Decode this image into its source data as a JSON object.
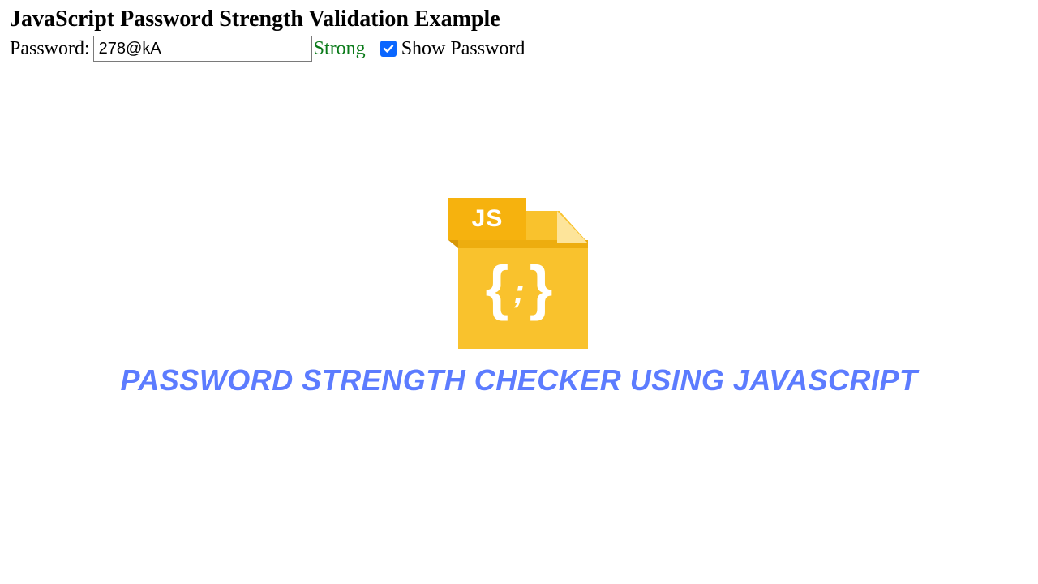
{
  "header": {
    "title": "JavaScript Password Strength Validation Example"
  },
  "form": {
    "password_label": "Password:",
    "password_value": "278@kA",
    "strength_text": "Strong",
    "show_password_label": "Show Password",
    "show_password_checked": true
  },
  "hero": {
    "icon_tag": "JS",
    "brace_left": "{",
    "brace_right": "}",
    "semicolon": ";",
    "title": "PASSWORD STRENGTH CHECKER USING JAVASCRIPT"
  },
  "colors": {
    "accent": "#0a66ff",
    "strength_ok": "#0a7a19",
    "hero_text": "#5c7cff",
    "file_body": "#f9c22d",
    "file_tag": "#f6b20e"
  }
}
